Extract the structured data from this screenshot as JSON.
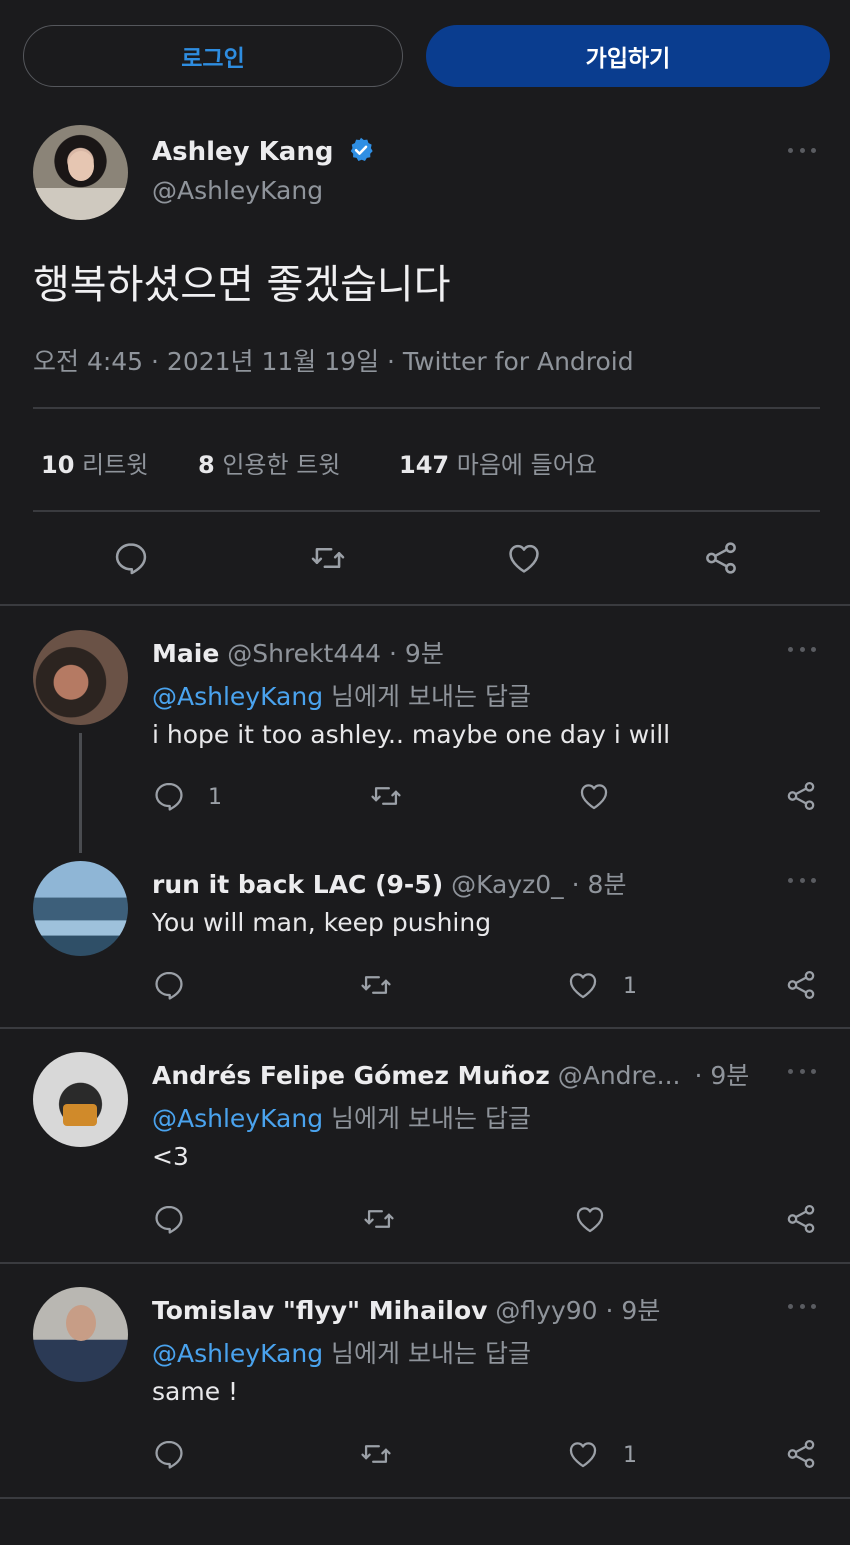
{
  "auth": {
    "login_label": "로그인",
    "signup_label": "가입하기"
  },
  "tweet": {
    "author_name": "Ashley Kang",
    "author_handle": "@AshleyKang",
    "text": "행복하셨으면 좋겠습니다",
    "meta": "오전 4:45 · 2021년 11월 19일 · Twitter for Android",
    "stats": {
      "retweets_count": "10",
      "retweets_label": "리트윗",
      "quotes_count": "8",
      "quotes_label": "인용한 트윗",
      "likes_count": "147",
      "likes_label": "마음에 들어요"
    }
  },
  "replies": [
    {
      "name": "Maie",
      "handle": "@Shrekt444",
      "time": "· 9분",
      "reply_to_handle": "@AshleyKang",
      "reply_to_suffix": "님에게 보내는 답글",
      "text": "i hope it too ashley.. maybe one day i will",
      "reply_count": "1",
      "like_count": ""
    },
    {
      "name": "run it back LAC (9-5)",
      "handle": "@Kayz0_",
      "time": "· 8분",
      "text": "You will man, keep pushing",
      "reply_count": "",
      "like_count": "1"
    },
    {
      "name": "Andrés Felipe Gómez Muñoz",
      "handle": "@Andre...",
      "time": "· 9분",
      "reply_to_handle": "@AshleyKang",
      "reply_to_suffix": "님에게 보내는 답글",
      "text": "<3",
      "reply_count": "",
      "like_count": ""
    },
    {
      "name": "Tomislav \"flyy\" Mihailov",
      "handle": "@flyy90",
      "time": "· 9분",
      "reply_to_handle": "@AshleyKang",
      "reply_to_suffix": "님에게 보내는 답글",
      "text": "same !",
      "reply_count": "",
      "like_count": "1"
    }
  ],
  "icons": {
    "reply": "reply-icon",
    "retweet": "retweet-icon",
    "like": "heart-icon",
    "share": "share-icon",
    "verified": "verified-badge-icon",
    "more": "more-options-icon"
  },
  "colors": {
    "background": "#1b1b1d",
    "accent": "#4aa3ee",
    "signup_bg": "#0a3d8f",
    "muted": "#8f949b"
  }
}
